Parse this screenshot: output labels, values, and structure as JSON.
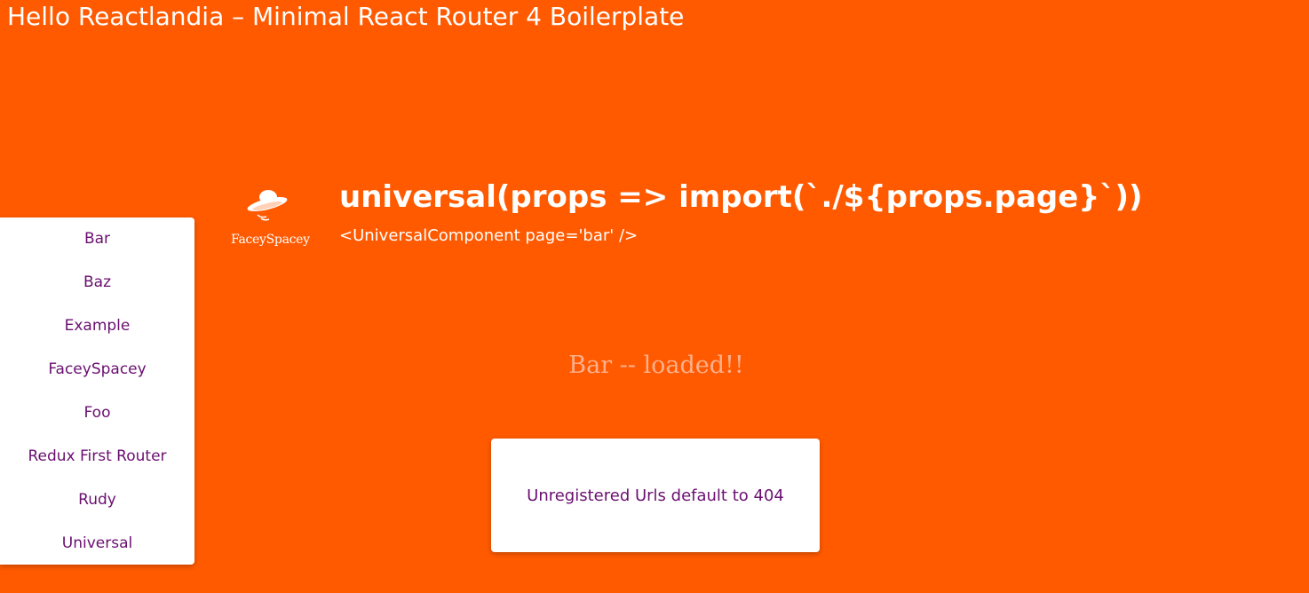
{
  "app": {
    "title": "Hello Reactlandia – Minimal React Router 4 Boilerplate"
  },
  "hero": {
    "logo_text": "FaceySpacey",
    "logo_icon": "flying-saucer-icon",
    "code": "universal(props => import(`./${props.page}`))",
    "subtitle": "<UniversalComponent page='bar' />"
  },
  "sidebar": {
    "items": [
      {
        "label": "Bar"
      },
      {
        "label": "Baz"
      },
      {
        "label": "Example"
      },
      {
        "label": "FaceySpacey"
      },
      {
        "label": "Foo"
      },
      {
        "label": "Redux First Router"
      },
      {
        "label": "Rudy"
      },
      {
        "label": "Universal"
      }
    ]
  },
  "main": {
    "loaded_text": "Bar -- loaded!!",
    "notice": "Unregistered Urls default to 404"
  },
  "colors": {
    "background": "#ff5a00",
    "link": "#6a0f70",
    "loaded_text": "#ffb08c"
  }
}
